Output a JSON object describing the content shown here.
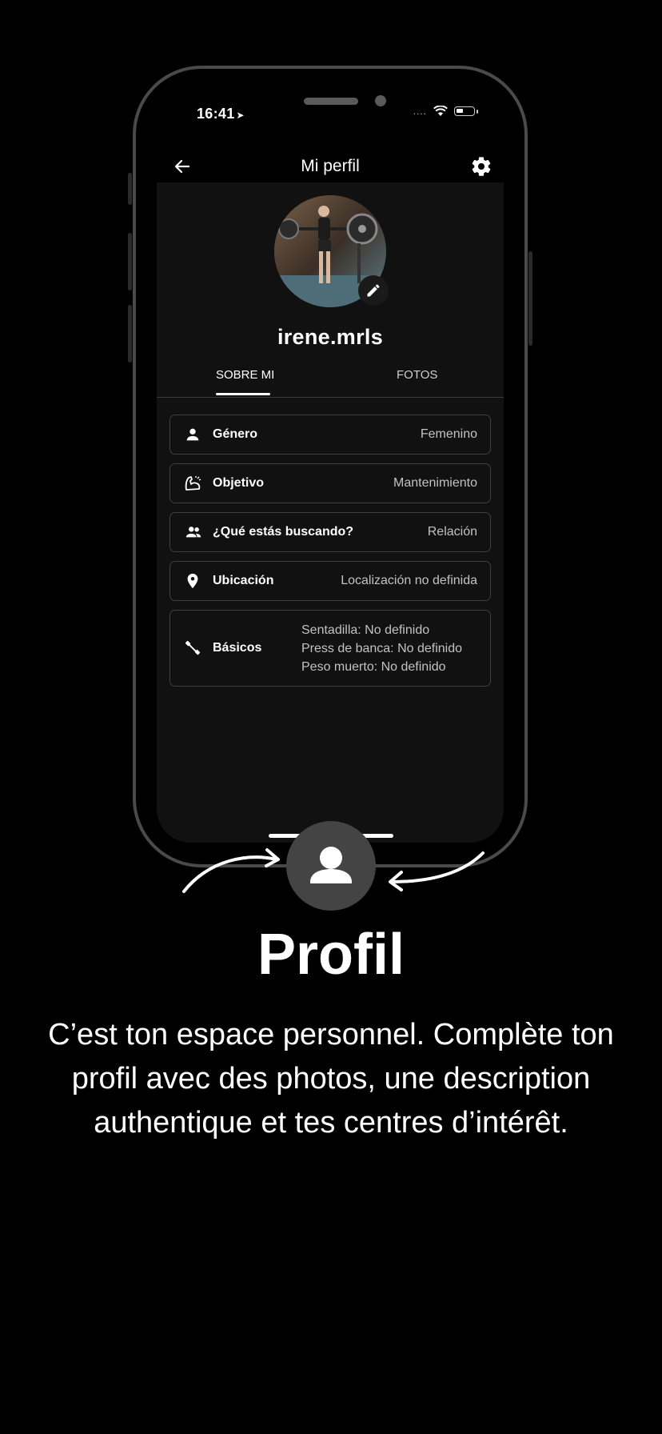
{
  "status_bar": {
    "time": "16:41"
  },
  "header": {
    "title": "Mi perfil"
  },
  "profile": {
    "username": "irene.mrls",
    "tabs": [
      {
        "label": "SOBRE MI",
        "active": true
      },
      {
        "label": "FOTOS",
        "active": false
      }
    ]
  },
  "rows": [
    {
      "icon": "person-icon",
      "label": "Género",
      "value": "Femenino"
    },
    {
      "icon": "flexed-arm-icon",
      "label": "Objetivo",
      "value": "Mantenimiento"
    },
    {
      "icon": "people-icon",
      "label": "¿Qué estás buscando?",
      "value": "Relación"
    },
    {
      "icon": "location-pin-icon",
      "label": "Ubicación",
      "value": "Localización no definida"
    },
    {
      "icon": "dumbbell-icon",
      "label": "Básicos",
      "values": [
        "Sentadilla: No definido",
        "Press de banca: No definido",
        "Peso muerto: No definido"
      ]
    }
  ],
  "promo": {
    "heading": "Profil",
    "description": "C’est ton espace personnel. Complète ton profil avec des photos, une description authentique et tes centres d’intérêt."
  },
  "colors": {
    "background": "#000000",
    "screen": "#111111",
    "frame": "#4a4a4a",
    "fab": "#444444"
  }
}
